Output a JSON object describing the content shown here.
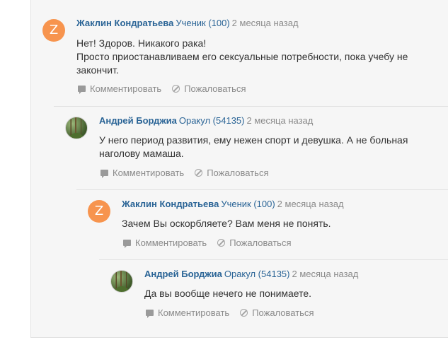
{
  "actions": {
    "comment": "Комментировать",
    "report": "Пожаловаться"
  },
  "comments": [
    {
      "avatar_letter": "Z",
      "author": "Жаклин Кондратьева",
      "rank": "Ученик (100)",
      "time": "2 месяца назад",
      "lines": [
        "Нет! Здоров. Никакого рака!",
        "Просто приостанавливаем его сексуальные потребности, пока учебу не",
        "закончит."
      ]
    },
    {
      "avatar_letter": "",
      "author": "Андрей Борджиа",
      "rank": "Оракул (54135)",
      "time": "2 месяца назад",
      "lines": [
        "У него период развития, ему нежен спорт и девушка. А не больная",
        "наголову мамаша."
      ]
    },
    {
      "avatar_letter": "Z",
      "author": "Жаклин Кондратьева",
      "rank": "Ученик (100)",
      "time": "2 месяца назад",
      "lines": [
        "Зачем Вы оскорбляете? Вам меня не понять."
      ]
    },
    {
      "avatar_letter": "",
      "author": "Андрей Борджиа",
      "rank": "Оракул (54135)",
      "time": "2 месяца назад",
      "lines": [
        "Да вы вообще нечего не понимаете."
      ]
    }
  ]
}
